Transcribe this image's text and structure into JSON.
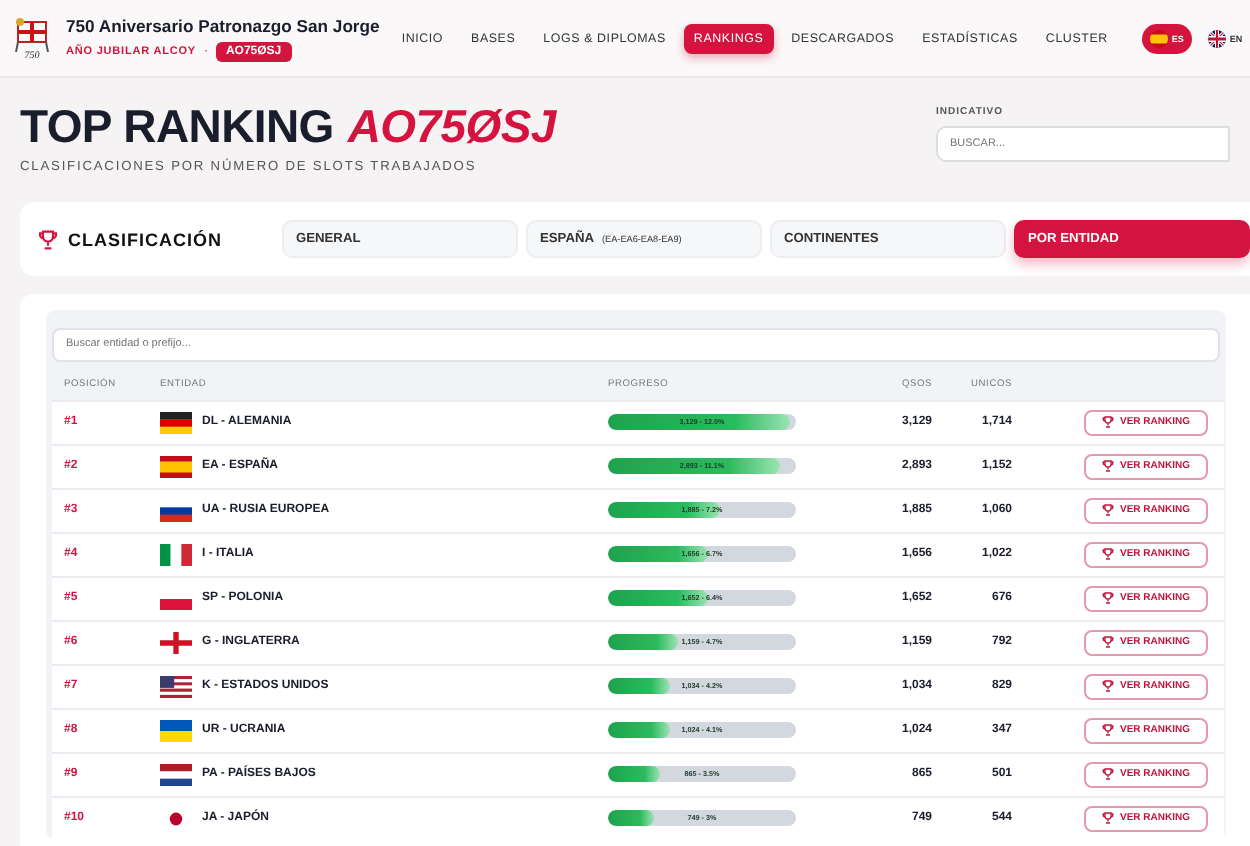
{
  "header": {
    "logo_text": "750",
    "title": "750 Aniversario Patronazgo San Jorge",
    "subtitle": "AÑO JUBILAR ALCOY",
    "separator": "·",
    "callsign_badge": "AO75ØSJ",
    "nav": [
      {
        "label": "INICIO",
        "selected": false
      },
      {
        "label": "BASES",
        "selected": false
      },
      {
        "label": "LOGS & DIPLOMAS",
        "selected": false
      },
      {
        "label": "RANKINGS",
        "selected": true
      },
      {
        "label": "DESCARGADOS",
        "selected": false
      },
      {
        "label": "ESTADÍSTICAS",
        "selected": false
      },
      {
        "label": "CLUSTER",
        "selected": false
      }
    ],
    "languages": [
      {
        "label": "ES",
        "kind": "es",
        "selected": true
      },
      {
        "label": "EN",
        "kind": "gb",
        "selected": false
      }
    ]
  },
  "page": {
    "title": "TOP RANKING",
    "title_accent": "AO75ØSJ",
    "subtitle": "CLASIFICACIONES POR NÚMERO DE SLOTS TRABAJADOS",
    "callsign_label": "INDICATIVO",
    "callsign_placeholder": "BUSCAR..."
  },
  "classification": {
    "label": "CLASIFICACIÓN",
    "tabs": [
      {
        "label": "GENERAL",
        "selected": false
      },
      {
        "label": "ESPAÑA",
        "note": "(EA-EA6-EA8-EA9)",
        "selected": false
      },
      {
        "label": "CONTINENTES",
        "selected": false
      },
      {
        "label": "POR ENTIDAD",
        "selected": true
      }
    ]
  },
  "table": {
    "search_placeholder": "Buscar entidad o prefijo...",
    "columns": [
      "POSICIÓN",
      "ENTIDAD",
      "PROGRESO",
      "QSOS",
      "UNICOS"
    ],
    "rows": [
      {
        "position": "#1",
        "kind": "de",
        "entity": "DL - ALEMANIA",
        "progress": "3,129 - 12.0%",
        "level": 0.97,
        "qsos": "3,129",
        "unicos": "1,714",
        "action": "VER RANKING"
      },
      {
        "position": "#2",
        "kind": "es",
        "entity": "EA - ESPAÑA",
        "progress": "2,893 - 11.1%",
        "level": 0.92,
        "qsos": "2,893",
        "unicos": "1,152",
        "action": "VER RANKING"
      },
      {
        "position": "#3",
        "kind": "ru",
        "entity": "UA - RUSIA EUROPEA",
        "progress": "1,885 - 7.2%",
        "level": 0.6,
        "qsos": "1,885",
        "unicos": "1,060",
        "action": "VER RANKING"
      },
      {
        "position": "#4",
        "kind": "it",
        "entity": "I - ITALIA",
        "progress": "1,656 - 6.7%",
        "level": 0.53,
        "qsos": "1,656",
        "unicos": "1,022",
        "action": "VER RANKING"
      },
      {
        "position": "#5",
        "kind": "pl",
        "entity": "SP - POLONIA",
        "progress": "1,652 - 6.4%",
        "level": 0.53,
        "qsos": "1,652",
        "unicos": "676",
        "action": "VER RANKING"
      },
      {
        "position": "#6",
        "kind": "en",
        "entity": "G - INGLATERRA",
        "progress": "1,159 - 4.7%",
        "level": 0.37,
        "qsos": "1,159",
        "unicos": "792",
        "action": "VER RANKING"
      },
      {
        "position": "#7",
        "kind": "us",
        "entity": "K - ESTADOS UNIDOS",
        "progress": "1,034 - 4.2%",
        "level": 0.33,
        "qsos": "1,034",
        "unicos": "829",
        "action": "VER RANKING"
      },
      {
        "position": "#8",
        "kind": "ua",
        "entity": "UR - UCRANIA",
        "progress": "1,024 - 4.1%",
        "level": 0.33,
        "qsos": "1,024",
        "unicos": "347",
        "action": "VER RANKING"
      },
      {
        "position": "#9",
        "kind": "nl",
        "entity": "PA - PAÍSES BAJOS",
        "progress": "865 - 3.5%",
        "level": 0.28,
        "qsos": "865",
        "unicos": "501",
        "action": "VER RANKING"
      },
      {
        "position": "#10",
        "kind": "jp",
        "entity": "JA - JAPÓN",
        "progress": "749 - 3%",
        "level": 0.24,
        "qsos": "749",
        "unicos": "544",
        "action": "VER RANKING"
      }
    ]
  }
}
